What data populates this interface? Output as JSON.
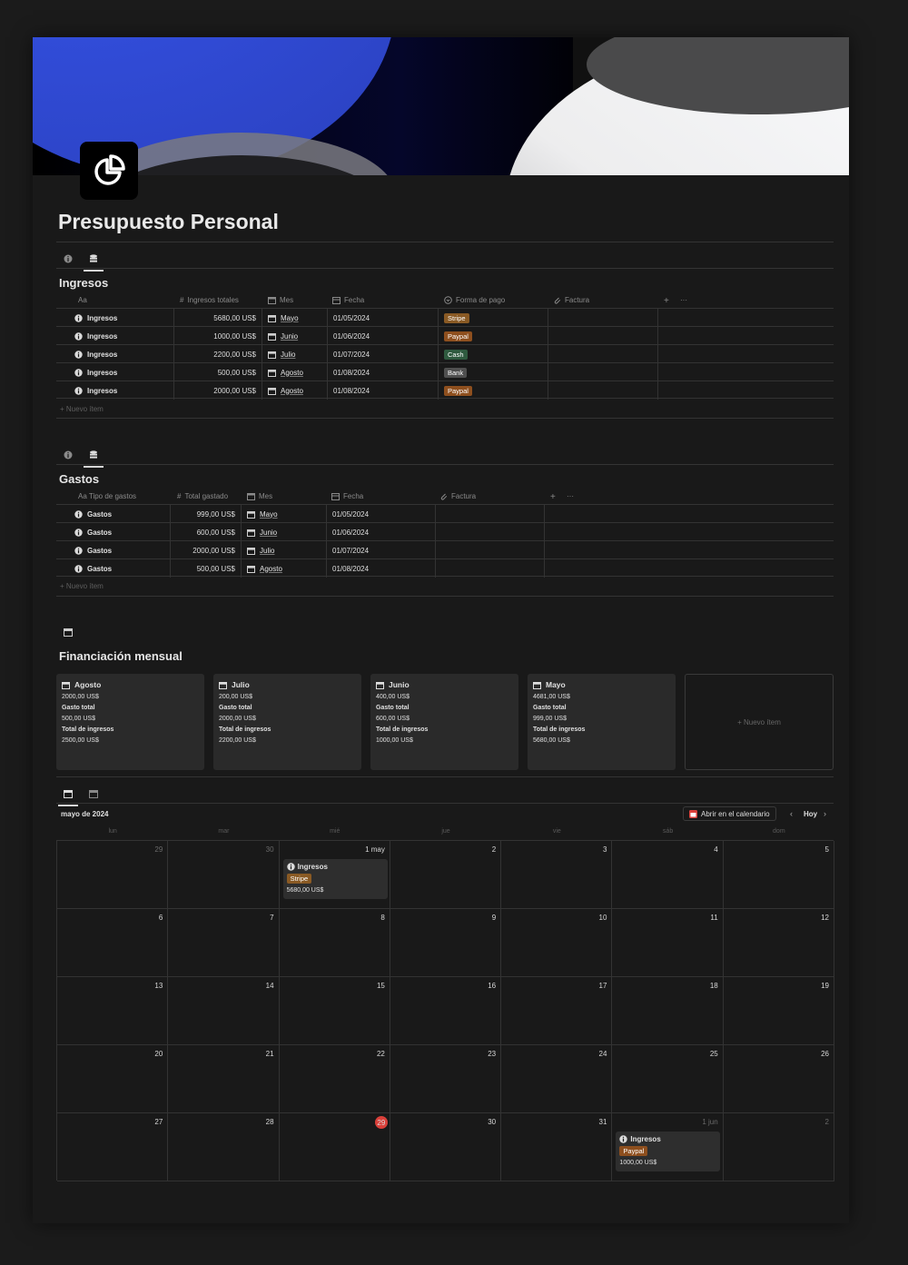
{
  "page": {
    "title": "Presupuesto Personal"
  },
  "ingresos": {
    "title": "Ingresos",
    "columns": [
      "Aa",
      "Ingresos totales",
      "Mes",
      "Fecha",
      "Forma de pago",
      "Factura"
    ],
    "rows": [
      {
        "name": "Ingresos",
        "amount": "5680,00 US$",
        "mes": "Mayo",
        "fecha": "01/05/2024",
        "pago": "Stripe",
        "pago_color": "#8a5a24"
      },
      {
        "name": "Ingresos",
        "amount": "1000,00 US$",
        "mes": "Junio",
        "fecha": "01/06/2024",
        "pago": "Paypal",
        "pago_color": "#8e4f1e"
      },
      {
        "name": "Ingresos",
        "amount": "2200,00 US$",
        "mes": "Julio",
        "fecha": "01/07/2024",
        "pago": "Cash",
        "pago_color": "#2f5a3f"
      },
      {
        "name": "Ingresos",
        "amount": "500,00 US$",
        "mes": "Agosto",
        "fecha": "01/08/2024",
        "pago": "Bank",
        "pago_color": "#4f4f4f"
      },
      {
        "name": "Ingresos",
        "amount": "2000,00 US$",
        "mes": "Agosto",
        "fecha": "01/08/2024",
        "pago": "Paypal",
        "pago_color": "#8e4f1e"
      }
    ],
    "new_item": "+ Nuevo ítem"
  },
  "gastos": {
    "title": "Gastos",
    "columns": [
      "Aa Tipo de gastos",
      "Total gastado",
      "Mes",
      "Fecha",
      "Factura"
    ],
    "rows": [
      {
        "name": "Gastos",
        "amount": "999,00 US$",
        "mes": "Mayo",
        "fecha": "01/05/2024"
      },
      {
        "name": "Gastos",
        "amount": "600,00 US$",
        "mes": "Junio",
        "fecha": "01/06/2024"
      },
      {
        "name": "Gastos",
        "amount": "2000,00 US$",
        "mes": "Julio",
        "fecha": "01/07/2024"
      },
      {
        "name": "Gastos",
        "amount": "500,00 US$",
        "mes": "Agosto",
        "fecha": "01/08/2024"
      }
    ],
    "new_item": "+ Nuevo ítem"
  },
  "financiacion": {
    "title": "Financiación mensual",
    "cards": [
      {
        "mes": "Agosto",
        "v1": "2000,00 US$",
        "l2": "Gasto total",
        "v2": "500,00 US$",
        "l3": "Total de ingresos",
        "v3": "2500,00 US$"
      },
      {
        "mes": "Julio",
        "v1": "200,00 US$",
        "l2": "Gasto total",
        "v2": "2000,00 US$",
        "l3": "Total de ingresos",
        "v3": "2200,00 US$"
      },
      {
        "mes": "Junio",
        "v1": "400,00 US$",
        "l2": "Gasto total",
        "v2": "600,00 US$",
        "l3": "Total de ingresos",
        "v3": "1000,00 US$"
      },
      {
        "mes": "Mayo",
        "v1": "4681,00 US$",
        "l2": "Gasto total",
        "v2": "999,00 US$",
        "l3": "Total de ingresos",
        "v3": "5680,00 US$"
      }
    ],
    "new_item": "+ Nuevo ítem"
  },
  "calendar": {
    "month_label": "mayo de 2024",
    "open_btn": "Abrir en el calendario",
    "today_btn": "Hoy",
    "prev": "‹",
    "next": "›",
    "weekdays": [
      "lun",
      "mar",
      "mié",
      "jue",
      "vie",
      "sáb",
      "dom"
    ],
    "days": [
      "29",
      "30",
      "1 may",
      "2",
      "3",
      "4",
      "5",
      "6",
      "7",
      "8",
      "9",
      "10",
      "11",
      "12",
      "13",
      "14",
      "15",
      "16",
      "17",
      "18",
      "19",
      "20",
      "21",
      "22",
      "23",
      "24",
      "25",
      "26",
      "27",
      "28",
      "29",
      "30",
      "31",
      "1 jun",
      "2"
    ],
    "event1": {
      "title": "Ingresos",
      "tag": "Stripe",
      "tag_color": "#8a5a24",
      "amount": "5680,00 US$"
    },
    "event2": {
      "title": "Ingresos",
      "tag": "Paypal",
      "tag_color": "#8e4f1e",
      "amount": "1000,00 US$"
    }
  }
}
